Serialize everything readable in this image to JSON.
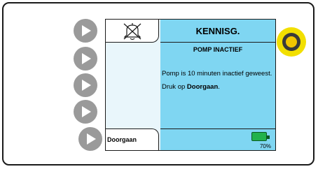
{
  "screen": {
    "title": "KENNISG.",
    "subtitle": "POMP INACTIEF",
    "message_line1": "Pomp is 10 minuten inactief geweest.",
    "message_line2_prefix": "Druk op ",
    "message_line2_bold": "Doorgaan",
    "message_line2_suffix": ".",
    "alarm_icon": "alarm-silenced-bell-icon"
  },
  "softkeys": {
    "bottom_left_label": "Doorgaan"
  },
  "battery": {
    "percent_label": "70%",
    "level": 0.7,
    "color": "#22b24c"
  },
  "side_buttons": {
    "count": 5,
    "icon": "play-arrow-icon"
  },
  "colors": {
    "panel_bg": "#7fd6f2",
    "left_col_bg": "#e9f6fb",
    "knob_ring": "#f2df00"
  }
}
